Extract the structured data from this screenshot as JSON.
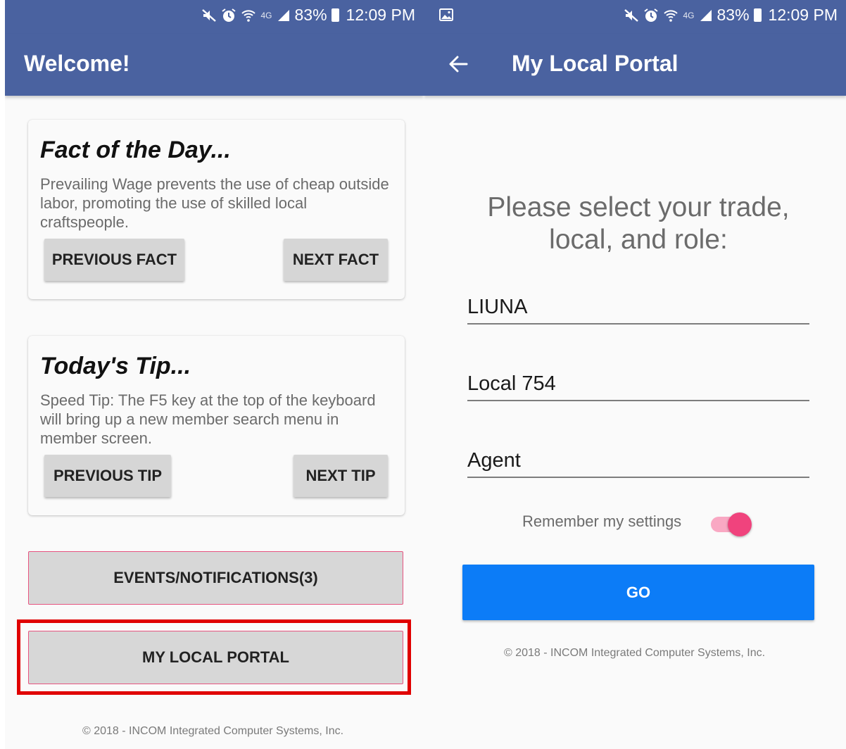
{
  "status_bar": {
    "battery_percent": "83%",
    "time": "12:09 PM",
    "network_label": "4G",
    "icons": [
      "mute-icon",
      "alarm-icon",
      "wifi-icon",
      "signal-icon",
      "battery-icon"
    ]
  },
  "left_screen": {
    "title": "Welcome!",
    "fact_card": {
      "title": "Fact of the Day...",
      "body": "Prevailing Wage prevents the use of cheap outside labor, promoting the use of skilled local craftspeople.",
      "prev_label": "PREVIOUS FACT",
      "next_label": "NEXT FACT"
    },
    "tip_card": {
      "title": "Today's Tip...",
      "body": "Speed Tip: The F5 key at the top of the keyboard will bring up a new member search menu in member screen.",
      "prev_label": "PREVIOUS TIP",
      "next_label": "NEXT TIP"
    },
    "events_label": "EVENTS/NOTIFICATIONS(3)",
    "portal_label": "MY LOCAL PORTAL",
    "footer": "© 2018 - INCOM Integrated Computer Systems, Inc."
  },
  "right_screen": {
    "title": "My Local Portal",
    "prompt": "Please select your trade, local, and role:",
    "trade_value": "LIUNA",
    "local_value": "Local 754",
    "role_value": "Agent",
    "remember_label": "Remember my settings",
    "remember_enabled": true,
    "go_label": "GO",
    "footer": "© 2018 - INCOM Integrated Computer Systems, Inc."
  },
  "colors": {
    "app_bar": "#4a62a0",
    "accent_pink": "#f0437d",
    "go_blue": "#0c7cf7",
    "highlight_red": "#e00000"
  }
}
